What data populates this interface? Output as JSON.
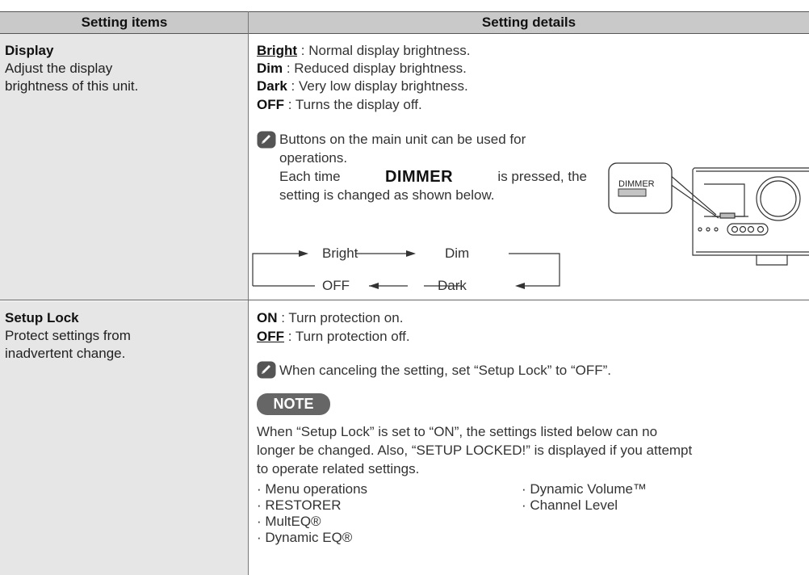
{
  "header": {
    "col1": "Setting items",
    "col2": "Setting details"
  },
  "display": {
    "title": "Display",
    "desc1": "Adjust the display",
    "desc2": "brightness of this unit.",
    "options": [
      {
        "name": "Bright",
        "desc": " : Normal display brightness."
      },
      {
        "name": "Dim",
        "desc": " : Reduced display brightness."
      },
      {
        "name": "Dark",
        "desc": " : Very low display brightness."
      },
      {
        "name": "OFF",
        "desc": " : Turns the display off."
      }
    ],
    "tip1": "Buttons on the main unit can be used for",
    "tip2": "operations.",
    "tip3a": "Each time",
    "tip3b": "DIMMER",
    "tip3c": "is pressed, the",
    "tip4": "setting is changed as shown below.",
    "cycle": {
      "bright": "Bright",
      "dim": "Dim",
      "off": "OFF",
      "dark": "Dark"
    },
    "button_label": "DIMMER"
  },
  "setup_lock": {
    "title": "Setup Lock",
    "desc1": "Protect settings from",
    "desc2": "inadvertent change.",
    "options": [
      {
        "name": "ON",
        "desc": " : Turn protection on."
      },
      {
        "name": "OFF",
        "desc": " : Turn protection off."
      }
    ],
    "tip": "When canceling the setting, set “Setup Lock” to “OFF”.",
    "note_label": "NOTE",
    "note1": "When “Setup Lock” is set to “ON”, the settings listed below can no",
    "note2": "longer be changed. Also, “SETUP LOCKED!” is displayed if you attempt",
    "note3": "to operate related settings.",
    "list_left": [
      "· Menu operations",
      "· RESTORER",
      "· MultEQ®",
      "· Dynamic EQ®"
    ],
    "list_right": [
      "· Dynamic Volume™",
      "· Channel Level"
    ]
  }
}
